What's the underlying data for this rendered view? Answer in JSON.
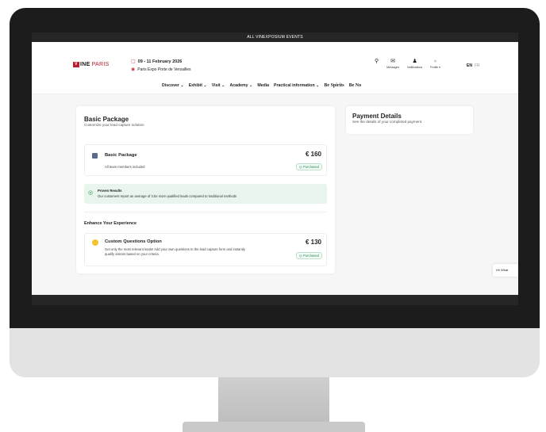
{
  "topbar": {
    "label": "ALL VINEXPOSIUM EVENTS"
  },
  "logo": {
    "mark": "V",
    "main": "INE",
    "city": "PARIS"
  },
  "event": {
    "date": "09 - 11 February 2026",
    "venue": "Paris Expo Porte de Versailles"
  },
  "header_icons": {
    "messages": "Messages",
    "notifications": "Notifications",
    "profile": "Profile ▾"
  },
  "lang": {
    "active": "EN",
    "other": "FR"
  },
  "nav": {
    "items": [
      "Discover ⌄",
      "Exhibit ⌄",
      "Visit ⌄",
      "Academy ⌄",
      "Media",
      "Practical information ⌄"
    ],
    "brand1": "Be Spirits",
    "brand2": "Be No"
  },
  "main": {
    "title": "Basic Package",
    "subtitle": "Customize your lead capture solution",
    "basic": {
      "name": "Basic Package",
      "desc": "All team members included",
      "price": "€ 160",
      "status": "Purchased"
    },
    "proven": {
      "title": "Proven Results",
      "text": "Our customers report an average of 3.5x more qualified leads compared to traditional methods"
    },
    "enhance_title": "Enhance Your Experience",
    "custom": {
      "name": "Custom Questions Option",
      "desc_line1": "Get only the most relevant leads! Add your own questions to the lead capture form and instantly",
      "desc_line2": "qualify visitors based on your criteria.",
      "price": "€ 130",
      "status": "Purchased"
    }
  },
  "payment": {
    "title": "Payment Details",
    "subtitle": "See the details of your completed payment."
  },
  "chat": {
    "label": "Hi! What"
  },
  "colors": {
    "brand": "#b81e2f",
    "success": "#2f8a58",
    "success_bg": "#e7f5ec",
    "dark": "#262626"
  }
}
